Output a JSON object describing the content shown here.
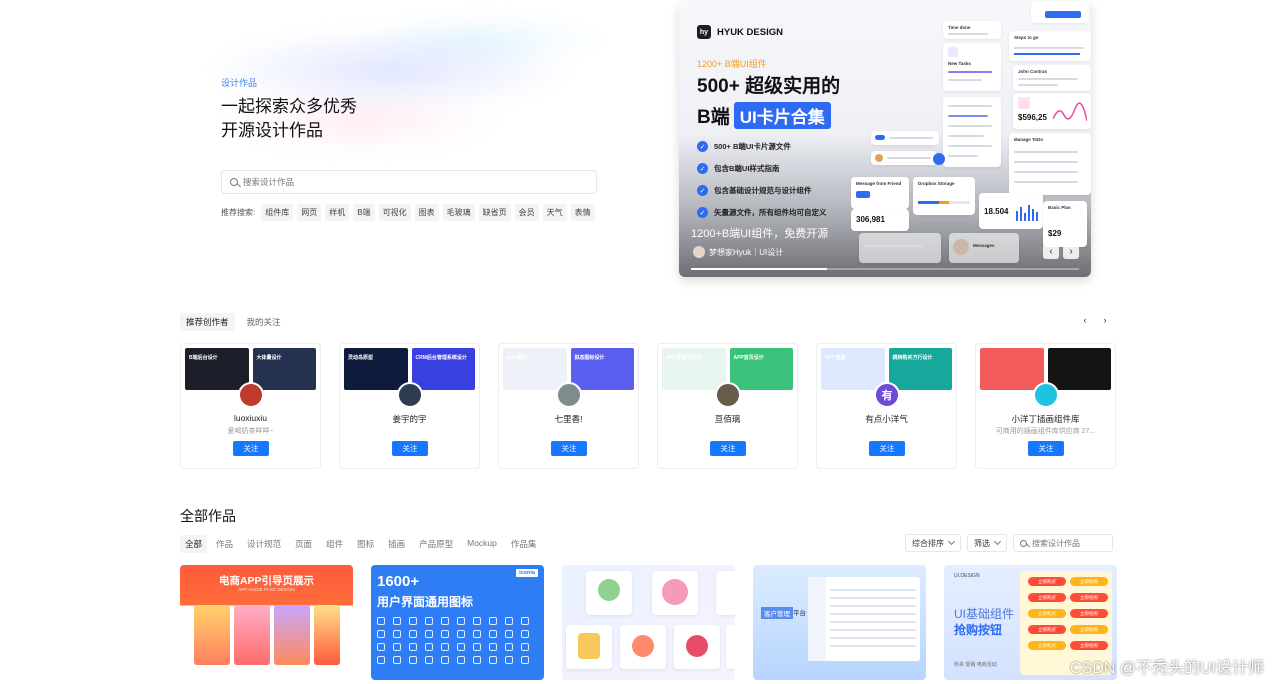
{
  "hero": {
    "eyebrow": "设计作品",
    "headline_line1": "一起探索众多优秀",
    "headline_line2": "开源设计作品",
    "search_placeholder": "搜索设计作品",
    "recommend_label": "推荐搜索:",
    "recommend_tags": [
      "组件库",
      "网页",
      "样机",
      "B端",
      "可视化",
      "图表",
      "毛玻璃",
      "缺省页",
      "会员",
      "天气",
      "表情"
    ]
  },
  "banner": {
    "brand": "HYUK DESIGN",
    "brand_logo": "hy",
    "subtitle": "1200+ B端UI组件",
    "title_line1": "500+ 超级实用的",
    "title_prefix": "B端",
    "title_chip": "UI卡片合集",
    "features": [
      "500+ B端UI卡片源文件",
      "包含B端UI样式指南",
      "包含基础设计规范与设计组件",
      "矢量源文件，所有组件均可自定义"
    ],
    "caption": "1200+B端UI组件，免费开源",
    "author": "梦想家Hyuk｜UI设计",
    "prev": "‹",
    "next": "›",
    "progress": 0.35,
    "mockups": [
      {
        "title": "Time done",
        "value": ""
      },
      {
        "title": "Steps to go",
        "value": ""
      },
      {
        "title": "New Tasks",
        "value": ""
      },
      {
        "title": "John Contras",
        "value": ""
      },
      {
        "title": "",
        "value": "$596,25"
      },
      {
        "title": "Manage ToDo",
        "value": ""
      },
      {
        "title": "Message from Friend",
        "value": ""
      },
      {
        "title": "Dropbox Storage",
        "value": ""
      },
      {
        "title": "",
        "value": "306,981"
      },
      {
        "title": "",
        "value": "18.504"
      },
      {
        "title": "Basic Plan",
        "value": "$29"
      },
      {
        "title": "Messages",
        "value": ""
      }
    ]
  },
  "creators_section": {
    "tabs": [
      "推荐创作者",
      "我的关注"
    ],
    "prev": "‹",
    "next": "›",
    "follow_label": "关注",
    "items": [
      {
        "name": "luoxiuxiu",
        "desc": "爱喝奶茶咩咩~",
        "avatar_color": "#c0392b",
        "avatar_letter": "",
        "thumbs": [
          {
            "text": "B端后台设计",
            "color": "#1c1f2a"
          },
          {
            "text": "大体量设计",
            "color": "#24324f"
          }
        ]
      },
      {
        "name": "姜宇的宇",
        "desc": "",
        "avatar_color": "#2c3e50",
        "avatar_letter": "",
        "thumbs": [
          {
            "text": "灵动岛原型",
            "color": "#0e1b3d"
          },
          {
            "text": "CRM后台管理系统设计",
            "color": "#3a3fe0"
          }
        ]
      },
      {
        "name": "七里香!",
        "desc": "",
        "avatar_color": "#7f8c8d",
        "avatar_letter": "",
        "thumbs": [
          {
            "text": "icon图标",
            "color": "#eef2f8"
          },
          {
            "text": "拟态图标设计",
            "color": "#5b5ff0"
          }
        ]
      },
      {
        "name": "亘佰璃",
        "desc": "",
        "avatar_color": "#6b5b4b",
        "avatar_letter": "",
        "thumbs": [
          {
            "text": "APP界面引导页",
            "color": "#e9f5ef"
          },
          {
            "text": "APP首页设计",
            "color": "#3ac27a"
          }
        ]
      },
      {
        "name": "有点小洋气",
        "desc": "",
        "avatar_color": "#6d4bd6",
        "avatar_letter": "有",
        "thumbs": [
          {
            "text": "43个旅游",
            "color": "#dde8ff"
          },
          {
            "text": "跳转购买方行设计",
            "color": "#16a89a"
          }
        ]
      },
      {
        "name": "小洋丁插画组件库",
        "desc": "可商用的插画组件库供应商 27...",
        "avatar_color": "#1ec3e0",
        "avatar_letter": "",
        "thumbs": [
          {
            "text": "",
            "color": "#f25c5c"
          },
          {
            "text": "",
            "color": "#141414"
          }
        ]
      }
    ]
  },
  "works_section": {
    "title": "全部作品",
    "tabs": [
      "全部",
      "作品",
      "设计规范",
      "页面",
      "组件",
      "图标",
      "插画",
      "产品原型",
      "Mockup",
      "作品集"
    ],
    "sort_label": "综合排序",
    "filter_label": "筛选",
    "search_placeholder": "搜索设计作品",
    "cards": {
      "w1_title": "电商APP引导页展示",
      "w1_sub": "APP GUIDE PAGE DESIGN",
      "w2_title1": "1600+",
      "w2_title2": "用户界面通用图标",
      "w2_badge": "iconia",
      "w4_label": "客户管理",
      "w4_suffix": "平台",
      "w5_brand": "UI.DESIGN",
      "w5_title1": "UI基础组件",
      "w5_title2": "抢购按钮",
      "w5_foot": "秒杀  促销  电商活动",
      "w5_btn1": "立即购买",
      "w5_btn2": "立即抢购"
    }
  },
  "watermark": "CSDN @不秃头的UI设计师"
}
